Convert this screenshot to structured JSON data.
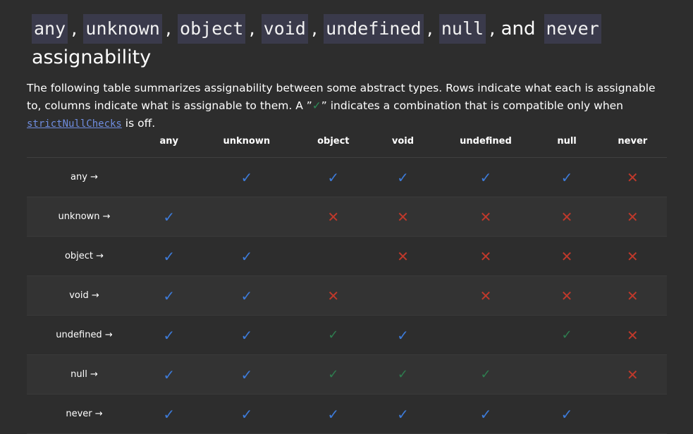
{
  "title": {
    "types": [
      "any",
      "unknown",
      "object",
      "void",
      "undefined",
      "null",
      "never"
    ],
    "sep": ",",
    "and": ", and",
    "suffix": "assignability"
  },
  "description": {
    "part1": "The following table summarizes assignability between some abstract types. Rows indicate what each is assignable to, columns indicate what is assignable to them. A ”",
    "check": "✓",
    "part2": "” indicates a combination that is compatible only when ",
    "link": "strictNullChecks",
    "part3": " is off."
  },
  "table": {
    "columns": [
      "",
      "any",
      "unknown",
      "object",
      "void",
      "undefined",
      "null",
      "never"
    ],
    "rows": [
      {
        "label": "any →",
        "cells": [
          "",
          "yes",
          "yes",
          "yes",
          "yes",
          "yes",
          "no"
        ]
      },
      {
        "label": "unknown →",
        "cells": [
          "yes",
          "",
          "no",
          "no",
          "no",
          "no",
          "no"
        ]
      },
      {
        "label": "object →",
        "cells": [
          "yes",
          "yes",
          "",
          "no",
          "no",
          "no",
          "no"
        ]
      },
      {
        "label": "void →",
        "cells": [
          "yes",
          "yes",
          "no",
          "",
          "no",
          "no",
          "no"
        ]
      },
      {
        "label": "undefined →",
        "cells": [
          "yes",
          "yes",
          "loose",
          "yes",
          "",
          "loose",
          "no"
        ]
      },
      {
        "label": "null →",
        "cells": [
          "yes",
          "yes",
          "loose",
          "loose",
          "loose",
          "",
          "no"
        ]
      },
      {
        "label": "never →",
        "cells": [
          "yes",
          "yes",
          "yes",
          "yes",
          "yes",
          "yes",
          ""
        ]
      }
    ],
    "symbols": {
      "yes": "✓",
      "no": "✕",
      "loose": "✓"
    },
    "colors": {
      "yes": "#3d7bd9",
      "no": "#c0392b",
      "loose": "#2e7d4f"
    }
  }
}
